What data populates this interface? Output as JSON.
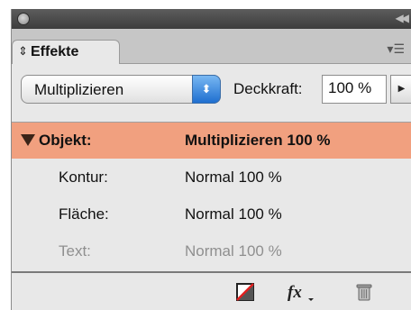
{
  "panel": {
    "tab_label": "Effekte",
    "mode_dropdown": {
      "value": "Multiplizieren"
    },
    "opacity": {
      "label": "Deckkraft:",
      "value": "100 %"
    },
    "rows": [
      {
        "label": "Objekt:",
        "value": "Multiplizieren 100 %",
        "selected": true
      },
      {
        "label": "Kontur:",
        "value": "Normal 100 %"
      },
      {
        "label": "Fläche:",
        "value": "Normal 100 %"
      },
      {
        "label": "Text:",
        "value": "Normal 100 %",
        "dimmed": true
      }
    ],
    "selected_row_color": "#f1a07f",
    "accent_color": "#1f6fd0",
    "icons": [
      "close-icon",
      "collapse-icon",
      "tab-arrows-icon",
      "panel-menu-icon",
      "dropdown-stepper-icon",
      "play-arrow-icon",
      "disclosure-triangle-icon",
      "clear-effects-icon",
      "fx-icon",
      "trash-icon"
    ]
  }
}
